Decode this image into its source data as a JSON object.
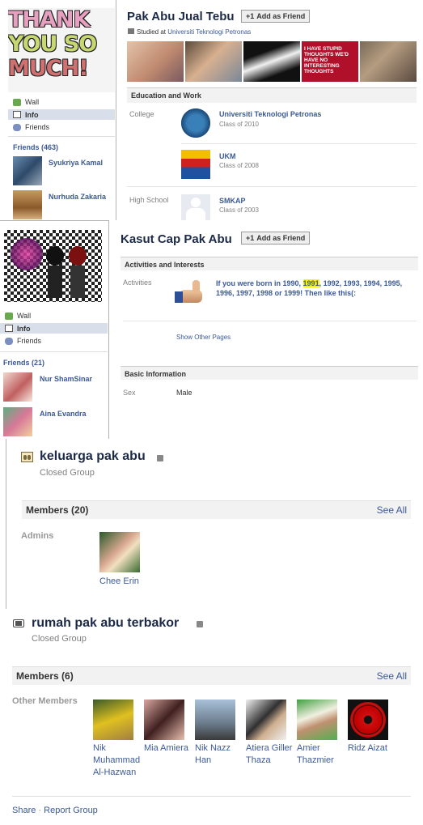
{
  "profile1": {
    "name": "Pak Abu Jual Tebu",
    "add_friend": "Add as Friend",
    "studied_at_prefix": "Studied at",
    "studied_at": "Universiti Teknologi Petronas",
    "profile_pic_text": [
      "THANK",
      "YOU SO",
      "MUCH!"
    ],
    "nav": {
      "wall": "Wall",
      "info": "Info",
      "friends": "Friends"
    },
    "friends_header": "Friends (463)",
    "friends": [
      {
        "name": "Syukriya Kamal"
      },
      {
        "name": "Nurhuda Zakaria"
      }
    ],
    "photo_text": "I HAVE STUPID THOUGHTS WE'D HAVE NO INTERESTING THOUGHTS",
    "edu_header": "Education and Work",
    "college_label": "College",
    "high_school_label": "High School",
    "schools": [
      {
        "name": "Universiti Teknologi Petronas",
        "sub": "Class of 2010"
      },
      {
        "name": "UKM",
        "sub": "Class of 2008"
      },
      {
        "name": "SMKAP",
        "sub": "Class of 2003"
      }
    ]
  },
  "profile2": {
    "name": "Kasut Cap Pak Abu",
    "add_friend": "Add as Friend",
    "nav": {
      "wall": "Wall",
      "info": "Info",
      "friends": "Friends"
    },
    "friends_header": "Friends (21)",
    "friends": [
      {
        "name": "Nur ShamSinar"
      },
      {
        "name": "Aina Evandra"
      }
    ],
    "activities_header": "Activities and Interests",
    "activities_label": "Activities",
    "activity_text_before": "If you were born in 1990,",
    "activity_highlight": "1991",
    "activity_text_after": ", 1992, 1993, 1994, 1995, 1996, 1997, 1998 or 1999! Then like this(:",
    "show_other": "Show Other Pages",
    "basic_header": "Basic Information",
    "sex_label": "Sex",
    "sex_value": "Male"
  },
  "group1": {
    "name": "keluarga pak abu",
    "type": "Closed Group",
    "members_header": "Members (20)",
    "see_all": "See All",
    "admins_label": "Admins",
    "admins": [
      {
        "name": "Chee Erin"
      }
    ]
  },
  "group2": {
    "name": "rumah pak abu terbakor",
    "type": "Closed Group",
    "members_header": "Members (6)",
    "see_all": "See All",
    "other_label": "Other Members",
    "members": [
      {
        "name": "Nik Muhammad Al-Hazwan"
      },
      {
        "name": "Mia Amiera"
      },
      {
        "name": "Nik Nazz Han"
      },
      {
        "name": "Atiera Giller Thaza"
      },
      {
        "name": "Amier Thazmier"
      },
      {
        "name": "Ridz Aizat"
      }
    ],
    "share": "Share",
    "separator": "·",
    "report": "Report Group"
  },
  "colors": {
    "link": "#3b5998",
    "title": "#1c2a47",
    "highlight": "#fff200"
  }
}
